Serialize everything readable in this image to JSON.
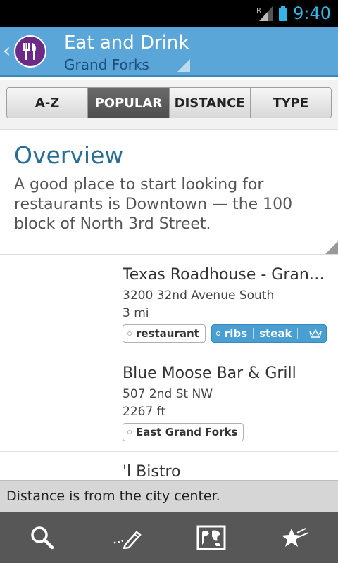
{
  "status_bar": {
    "time": "9:40",
    "roaming_label": "R",
    "signal_icon": "signal-icon",
    "battery_icon": "battery-icon"
  },
  "header": {
    "title": "Eat and Drink",
    "subtitle": "Grand Forks",
    "app_icon": "fork-knife-icon",
    "brand_color": "#5aa6d8",
    "icon_color": "#6a2a86"
  },
  "tabs": [
    {
      "label": "A-Z",
      "active": false
    },
    {
      "label": "POPULAR",
      "active": true
    },
    {
      "label": "DISTANCE",
      "active": false
    },
    {
      "label": "TYPE",
      "active": false
    }
  ],
  "overview": {
    "title": "Overview",
    "text": "A good place to start looking for restaurants is Downtown — the 100 block of North 3rd Street."
  },
  "listings": [
    {
      "name": "Texas Roadhouse - Gran…",
      "address": "3200 32nd Avenue South",
      "distance": "3 mi",
      "tag": "restaurant",
      "blue_tags": [
        "ribs",
        "steak"
      ],
      "crown_icon": "crown-icon"
    },
    {
      "name": "Blue Moose Bar & Grill",
      "address": "507 2nd St NW",
      "distance": "2267 ft",
      "tag": "East Grand Forks"
    },
    {
      "name": "'l Bistro"
    }
  ],
  "toast": {
    "text": "Distance is from the city center."
  },
  "bottom_bar": {
    "icons": [
      "search-icon",
      "pencil-icon",
      "map-icon",
      "star-icon"
    ]
  }
}
